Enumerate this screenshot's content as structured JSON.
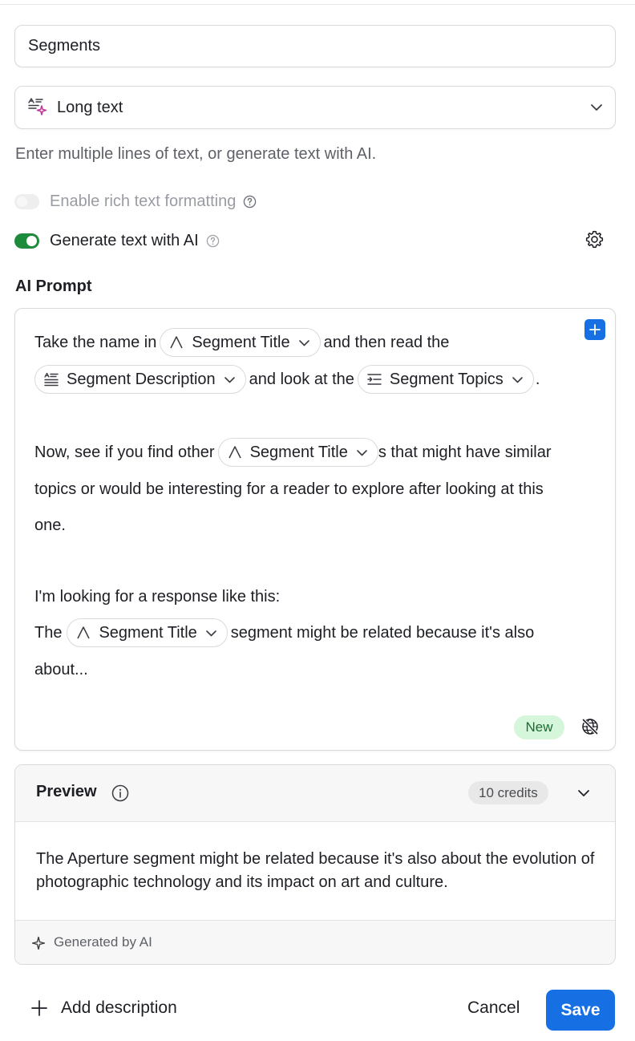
{
  "field": {
    "name_value": "Segments"
  },
  "type_select": {
    "label": "Long text",
    "icon": "long-text-ai-icon"
  },
  "helper_text": "Enter multiple lines of text, or generate text with AI.",
  "rich_text_toggle": {
    "label": "Enable rich text formatting",
    "enabled": false
  },
  "ai_toggle": {
    "label": "Generate text with AI",
    "enabled": true,
    "color": "#1e8a3b"
  },
  "ai_prompt": {
    "title": "AI Prompt",
    "lines": [
      {
        "pre": "Take the name in",
        "chip": "Segment Title",
        "post": "and then read the"
      },
      {
        "chip": "Segment Description",
        "mid": "and look at the",
        "chip2": "Segment Topics",
        "post": "."
      },
      {
        "pre": "Now, see if you find other",
        "chip": "Segment Title",
        "post": "s that might have similar"
      },
      {
        "text": "topics or would be interesting for a reader to explore after looking at this"
      },
      {
        "text": "one."
      },
      {
        "text": "I'm looking for a response like this:"
      },
      {
        "pre": "The",
        "chip": "Segment Title",
        "post": "segment might be related because it's also"
      },
      {
        "text": "about..."
      }
    ],
    "badge": "New"
  },
  "preview": {
    "title": "Preview",
    "credits": "10 credits",
    "body": "The Aperture segment might be related because it's also about the evolution of photographic technology and its impact on art and culture.",
    "footer": "Generated by AI"
  },
  "footer": {
    "add_description": "Add description",
    "cancel": "Cancel",
    "save": "Save"
  },
  "colors": {
    "accent": "#1670e3",
    "toggle_on": "#1e8a3b",
    "badge_bg": "#d6f6dc"
  }
}
